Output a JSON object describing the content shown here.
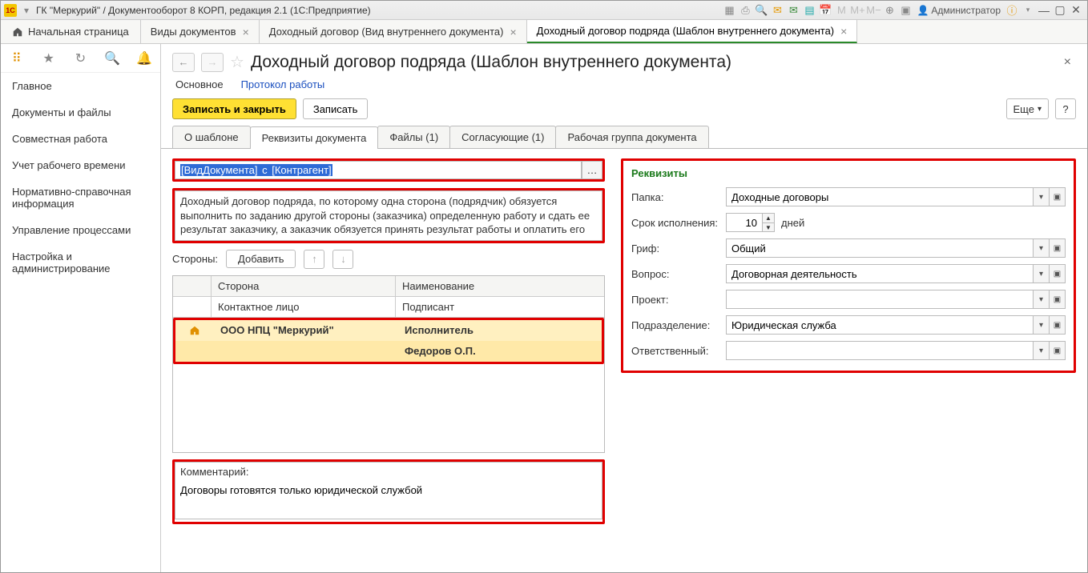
{
  "titlebar": {
    "title": "ГК \"Меркурий\" / Документооборот 8 КОРП, редакция 2.1  (1С:Предприятие)",
    "user": "Администратор"
  },
  "apptabs": {
    "home": "Начальная страница",
    "t1": "Виды документов",
    "t2": "Доходный договор (Вид внутреннего документа)",
    "t3": "Доходный договор подряда (Шаблон внутреннего документа)"
  },
  "sidebar": {
    "items": [
      "Главное",
      "Документы и файлы",
      "Совместная работа",
      "Учет рабочего времени",
      "Нормативно-справочная информация",
      "Управление процессами",
      "Настройка и администрирование"
    ]
  },
  "page": {
    "title": "Доходный договор подряда (Шаблон внутреннего документа)",
    "subnav": {
      "main": "Основное",
      "proto": "Протокол работы"
    },
    "buttons": {
      "saveclose": "Записать и закрыть",
      "save": "Записать",
      "more": "Еще"
    },
    "dtabs": {
      "about": "О шаблоне",
      "req": "Реквизиты документа",
      "files": "Файлы (1)",
      "appr": "Согласующие (1)",
      "wg": "Рабочая группа документа"
    },
    "template_field_p1": "[ВидДокумента]",
    "template_field_mid": " с ",
    "template_field_p2": "[Контрагент]",
    "description": "Доходный договор подряда, по которому  одна сторона (подрядчик) обязуется выполнить по заданию другой стороны (заказчика) определенную работу и сдать ее результат заказчику, а заказчик обязуется принять результат работы и оплатить его",
    "sides": {
      "label": "Стороны:",
      "add": "Добавить"
    },
    "grid": {
      "h1": "Сторона",
      "h2": "Наименование",
      "sh1": "Контактное лицо",
      "sh2": "Подписант",
      "r1c1": "ООО НПЦ \"Меркурий\"",
      "r1c2": "Исполнитель",
      "r2c2": "Федоров О.П."
    },
    "comment": {
      "label": "Комментарий:",
      "value": "Договоры готовятся только юридической службой"
    }
  },
  "props": {
    "title": "Реквизиты",
    "folder": {
      "label": "Папка:",
      "value": "Доходные договоры"
    },
    "due": {
      "label": "Срок исполнения:",
      "value": "10",
      "unit": "дней"
    },
    "stamp": {
      "label": "Гриф:",
      "value": "Общий"
    },
    "topic": {
      "label": "Вопрос:",
      "value": "Договорная деятельность"
    },
    "project": {
      "label": "Проект:",
      "value": ""
    },
    "dept": {
      "label": "Подразделение:",
      "value": "Юридическая служба"
    },
    "resp": {
      "label": "Ответственный:",
      "value": ""
    }
  }
}
